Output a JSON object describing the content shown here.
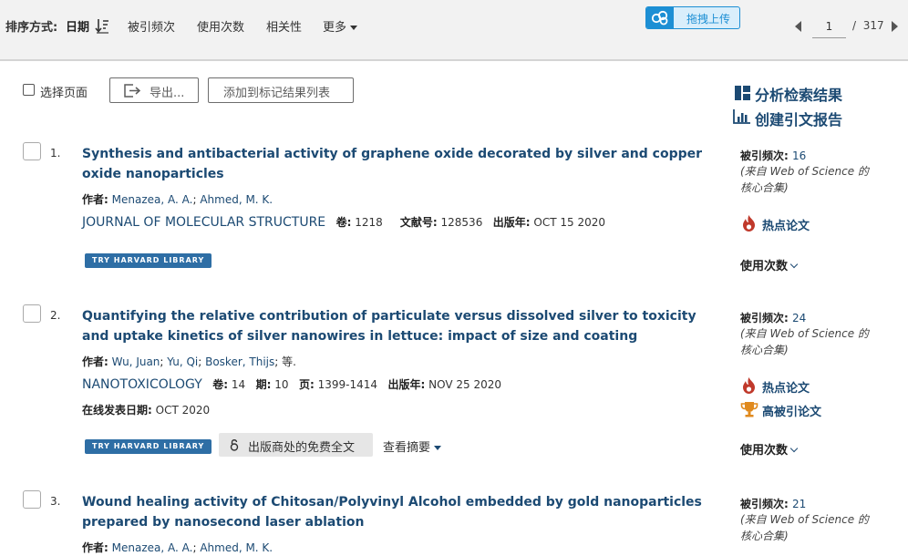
{
  "sort": {
    "label": "排序方式:",
    "active": "日期",
    "options": [
      "被引频次",
      "使用次数",
      "相关性"
    ],
    "more": "更多"
  },
  "upload": {
    "label": "拖拽上传"
  },
  "pager": {
    "current": "1",
    "separator": "/",
    "total": "317"
  },
  "toolbar": {
    "select_page": "选择页面",
    "export": "导出...",
    "add_marked": "添加到标记结果列表"
  },
  "side": {
    "analyze": "分析检索结果",
    "citation_report": "创建引文报告"
  },
  "records": [
    {
      "num": "1.",
      "title": "Synthesis and antibacterial activity of graphene oxide decorated by silver and copper oxide nanoparticles",
      "author_label": "作者:",
      "authors": [
        "Menazea, A. A.",
        "Ahmed, M. K."
      ],
      "journal": "JOURNAL OF MOLECULAR STRUCTURE",
      "volume_label": "卷:",
      "volume": "1218",
      "article_label": "文献号:",
      "article": "128536",
      "pub_label": "出版年:",
      "pub": "OCT 15 2020",
      "harvard": "TRY HARVARD LIBRARY",
      "cites_label": "被引频次:",
      "cites": "16",
      "cites_src": "(来自 Web of Science 的核心合集)",
      "hot": "热点论文",
      "usage": "使用次数"
    },
    {
      "num": "2.",
      "title": "Quantifying the relative contribution of particulate versus dissolved silver to toxicity and uptake kinetics of silver nanowires in lettuce: impact of size and coating",
      "author_label": "作者:",
      "authors": [
        "Wu, Juan",
        "Yu, Qi",
        "Bosker, Thijs"
      ],
      "authors_etc": "等.",
      "journal": "NANOTOXICOLOGY",
      "volume_label": "卷:",
      "volume": "14",
      "issue_label": "期:",
      "issue": "10",
      "pages_label": "页:",
      "pages": "1399-1414",
      "pub_label": "出版年:",
      "pub": "NOV 25 2020",
      "online_label": "在线发表日期:",
      "online": "OCT 2020",
      "harvard": "TRY HARVARD LIBRARY",
      "free_text": "出版商处的免费全文",
      "abstract": "查看摘要",
      "cites_label": "被引频次:",
      "cites": "24",
      "cites_src": "(来自 Web of Science 的核心合集)",
      "hot": "热点论文",
      "highly_cited": "高被引论文",
      "usage": "使用次数"
    },
    {
      "num": "3.",
      "title": "Wound healing activity of Chitosan/Polyvinyl Alcohol embedded by gold nanoparticles prepared by nanosecond laser ablation",
      "author_label": "作者:",
      "authors": [
        "Menazea, A. A.",
        "Ahmed, M. K."
      ],
      "cites_label": "被引频次:",
      "cites": "21",
      "cites_src": "(来自 Web of Science 的核心合集)"
    }
  ]
}
